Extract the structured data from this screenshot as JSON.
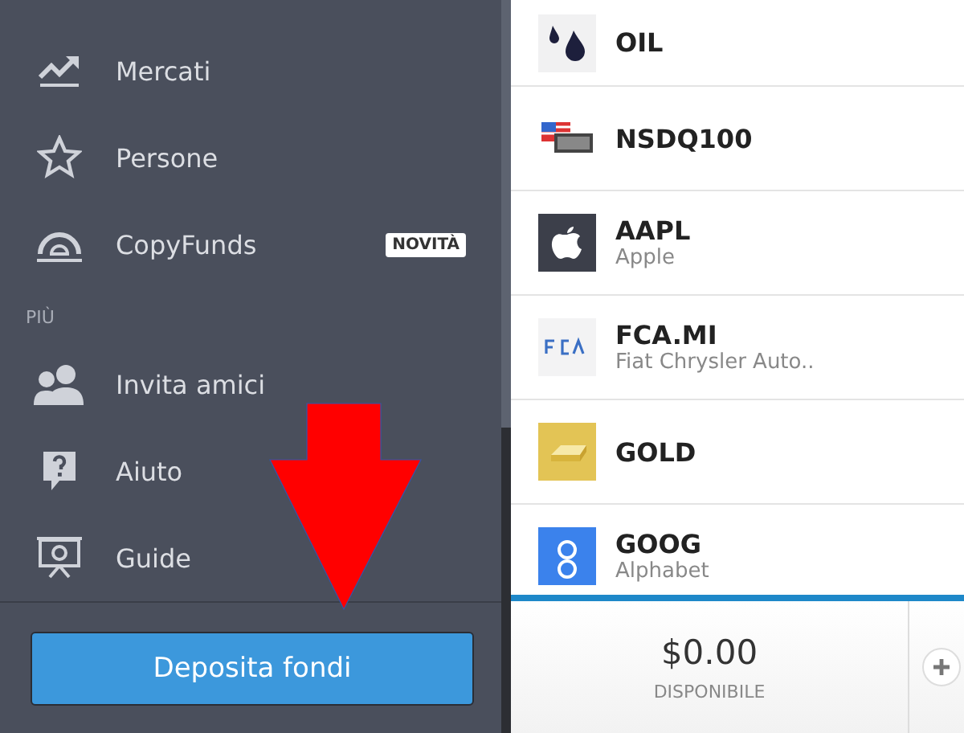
{
  "sidebar": {
    "sections": [
      {
        "items": [
          {
            "label": "Mercati"
          },
          {
            "label": "Persone"
          },
          {
            "label": "CopyFunds",
            "badge": "NOVITÀ"
          }
        ]
      },
      {
        "heading": "PIÙ",
        "items": [
          {
            "label": "Invita amici"
          },
          {
            "label": "Aiuto"
          },
          {
            "label": "Guide"
          }
        ]
      }
    ],
    "deposit_button": "Deposita fondi"
  },
  "instruments": [
    {
      "symbol": "OIL"
    },
    {
      "symbol": "NSDQ100"
    },
    {
      "symbol": "AAPL",
      "name": "Apple"
    },
    {
      "symbol": "FCA.MI",
      "name": "Fiat Chrysler Auto.."
    },
    {
      "symbol": "GOLD"
    },
    {
      "symbol": "GOOG",
      "name": "Alphabet"
    }
  ],
  "balance": {
    "amount": "$0.00",
    "label": "DISPONIBILE"
  }
}
